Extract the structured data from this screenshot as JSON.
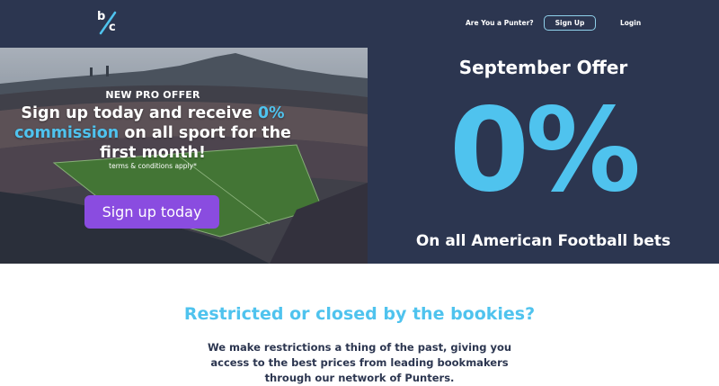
{
  "nav": {
    "logo_b": "b",
    "logo_c": "c",
    "punter_label": "Are You a Punter?",
    "signup_label": "Sign Up",
    "login_label": "Login"
  },
  "promo": {
    "kicker": "NEW PRO OFFER",
    "headline_part1": "Sign up today and receive ",
    "headline_highlight1": "0%",
    "headline_highlight2": "commission",
    "headline_part2": " on all sport for the first month!",
    "terms": "terms & conditions apply*",
    "cta_label": "Sign up today"
  },
  "september": {
    "title": "September Offer",
    "big_value": "0%",
    "subtitle": "On all American Football bets"
  },
  "info": {
    "title": "Restricted or closed by the bookies?",
    "body": "We make restrictions a thing of the past, giving you access to the best prices from leading bookmakers through our network of Punters."
  },
  "colors": {
    "navy": "#2c3650",
    "accent_blue": "#4fc3ee",
    "cta_purple": "#8a4ce0"
  }
}
